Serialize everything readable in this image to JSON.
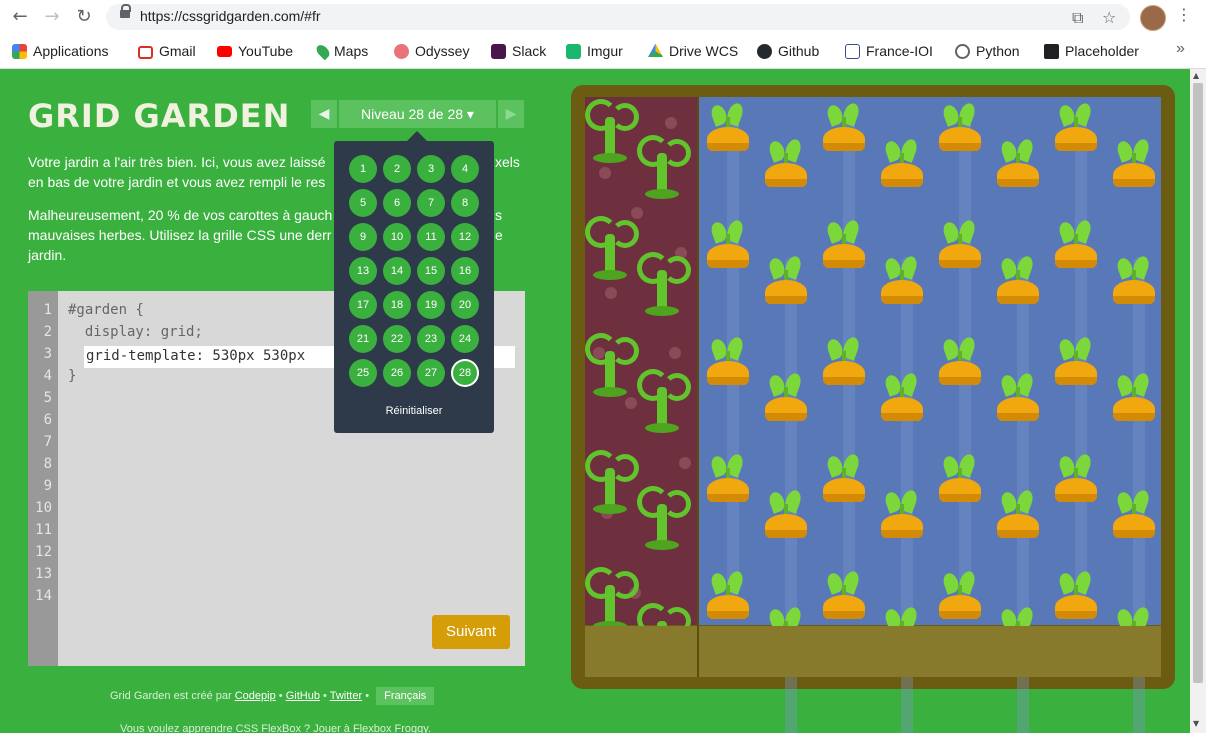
{
  "browser": {
    "url": "https://cssgridgarden.com/#fr",
    "bookmarks": [
      {
        "label": "Applications",
        "icon": "apps-grid-icon",
        "color": "#4285f4"
      },
      {
        "label": "Gmail",
        "icon": "gmail-icon",
        "color": "#d93025"
      },
      {
        "label": "YouTube",
        "icon": "youtube-icon",
        "color": "#ff0000"
      },
      {
        "label": "Maps",
        "icon": "maps-pin-icon",
        "color": "#34a853"
      },
      {
        "label": "Odyssey",
        "icon": "odyssey-icon",
        "color": "#e8737b"
      },
      {
        "label": "Slack",
        "icon": "slack-icon",
        "color": "#4a154b"
      },
      {
        "label": "Imgur",
        "icon": "imgur-icon",
        "color": "#1bb76e"
      },
      {
        "label": "Drive WCS",
        "icon": "drive-icon",
        "color": "#fbbc04"
      },
      {
        "label": "Github",
        "icon": "github-icon",
        "color": "#24292e"
      },
      {
        "label": "France-IOI",
        "icon": "france-ioi-icon",
        "color": "#3c4a8c"
      },
      {
        "label": "Python",
        "icon": "python-icon",
        "color": "#5f6368"
      },
      {
        "label": "Placeholder",
        "icon": "placeholder-icon",
        "color": "#202124"
      }
    ]
  },
  "header": {
    "title": "GRID GARDEN",
    "level_label": "Niveau 28 de 28 ▾"
  },
  "intro": {
    "p1": "Votre jardin a l'air très bien. Ici, vous avez laissé",
    "p1_cont": "xels",
    "p1_line2": "en bas de votre jardin et vous avez rempli le res",
    "p2_line1": "Malheureusement, 20 % de vos carottes à gauch",
    "p2_line1_cont": "s",
    "p2_line2": "mauvaises herbes. Utilisez la grille CSS une derr",
    "p2_line2_cont": "e",
    "p2_line3": "jardin."
  },
  "editor": {
    "line_numbers": [
      "1",
      "2",
      "3",
      "4",
      "5",
      "6",
      "7",
      "8",
      "9",
      "10",
      "11",
      "12",
      "13",
      "14"
    ],
    "line1": "#garden {",
    "line2": "  display: grid;",
    "input_value": "grid-template: 530px 530px",
    "line4": "}",
    "next_button": "Suivant"
  },
  "level_menu": {
    "levels": [
      "1",
      "2",
      "3",
      "4",
      "5",
      "6",
      "7",
      "8",
      "9",
      "10",
      "11",
      "12",
      "13",
      "14",
      "15",
      "16",
      "17",
      "18",
      "19",
      "20",
      "21",
      "22",
      "23",
      "24",
      "25",
      "26",
      "27",
      "28"
    ],
    "current": "28",
    "reset_label": "Réinitialiser"
  },
  "footer": {
    "created_by": "Grid Garden est créé par",
    "codepip": "Codepip",
    "github": "GitHub",
    "twitter": "Twitter",
    "sep": "•",
    "language": "Français",
    "promo": "Vous voulez apprendre CSS FlexBox ? Jouer à Flexbox Froggy."
  },
  "colors": {
    "page_bg": "#3ab03e",
    "button": "#d59d07",
    "weed_soil": "#6e2f3e",
    "water": "#5878b8",
    "carrot": "#f0a80e"
  }
}
